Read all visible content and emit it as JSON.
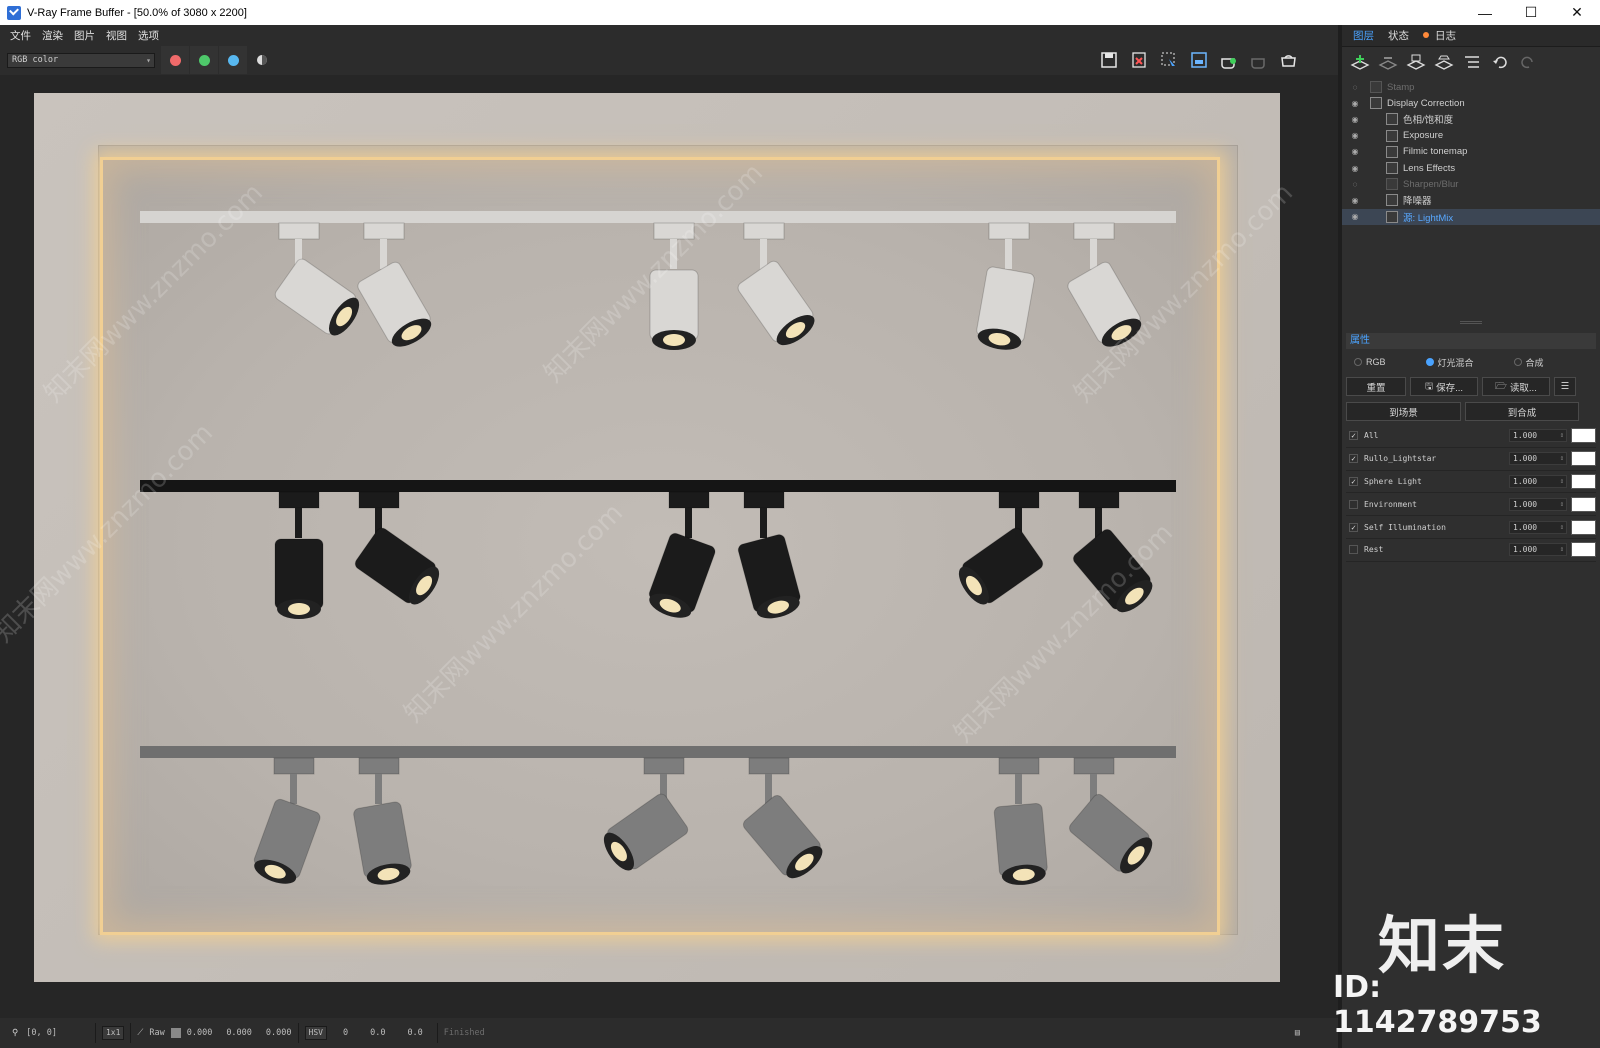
{
  "window": {
    "title": "V-Ray Frame Buffer - [50.0% of 3080 x 2200]",
    "controls": {
      "minimize": "—",
      "maximize": "☐",
      "close": "✕"
    }
  },
  "menu": [
    "文件",
    "渲染",
    "图片",
    "视图",
    "选项"
  ],
  "toolbar": {
    "channel": "RGB color",
    "swatches": [
      {
        "name": "red-channel",
        "color": "#f06a6a"
      },
      {
        "name": "green-channel",
        "color": "#4ec86a"
      },
      {
        "name": "blue-channel",
        "color": "#58b8f0"
      }
    ],
    "right_icons": [
      "save-icon",
      "clear-icon",
      "region-icon",
      "compare-icon",
      "render-icon",
      "stop-icon",
      "teapot-icon"
    ]
  },
  "status": {
    "coords": "[0, 0]",
    "zoom": "1x1",
    "mode": "Raw",
    "v1": "0.000",
    "v2": "0.000",
    "v3": "0.000",
    "color_space": "HSV",
    "h": "0",
    "s": "0.0",
    "v": "0.0",
    "state": "Finished"
  },
  "right_panel": {
    "tabs": [
      "图层",
      "状态",
      "日志"
    ],
    "layers": [
      {
        "label": "Stamp",
        "dim": true,
        "indent": 0
      },
      {
        "label": "Display Correction",
        "dim": false,
        "indent": 0
      },
      {
        "label": "色相/饱和度",
        "dim": false,
        "indent": 1
      },
      {
        "label": "Exposure",
        "dim": false,
        "indent": 1
      },
      {
        "label": "Filmic tonemap",
        "dim": false,
        "indent": 1
      },
      {
        "label": "Lens Effects",
        "dim": false,
        "indent": 1
      },
      {
        "label": "Sharpen/Blur",
        "dim": true,
        "indent": 1
      },
      {
        "label": "降噪器",
        "dim": false,
        "indent": 1
      },
      {
        "label": "源: LightMix",
        "dim": false,
        "indent": 1,
        "selected": true
      }
    ],
    "props_title": "属性",
    "modes": [
      "RGB",
      "灯光混合",
      "合成"
    ],
    "active_mode": 1,
    "buttons": {
      "reset": "重置",
      "save": "保存...",
      "load": "读取..."
    },
    "to_scene": "到场景",
    "to_composite": "到合成",
    "lightmix": [
      {
        "name": "All",
        "checked": true,
        "value": "1.000"
      },
      {
        "name": "Rullo_Lightstar",
        "checked": true,
        "value": "1.000"
      },
      {
        "name": "Sphere Light",
        "checked": true,
        "value": "1.000"
      },
      {
        "name": "Environment",
        "checked": false,
        "value": "1.000"
      },
      {
        "name": "Self Illumination",
        "checked": true,
        "value": "1.000"
      },
      {
        "name": "Rest",
        "checked": false,
        "value": "1.000"
      }
    ]
  },
  "render": {
    "rails": [
      {
        "color": "#d8d6d3",
        "body": "#d9d7d4"
      },
      {
        "color": "#1a1a1a",
        "body": "#1b1b1b"
      },
      {
        "color": "#767676",
        "body": "#7d7d7d"
      }
    ],
    "watermark_text": "知末网www.znzmo.com"
  },
  "brand": {
    "name": "知末",
    "id": "ID: 1142789753"
  }
}
